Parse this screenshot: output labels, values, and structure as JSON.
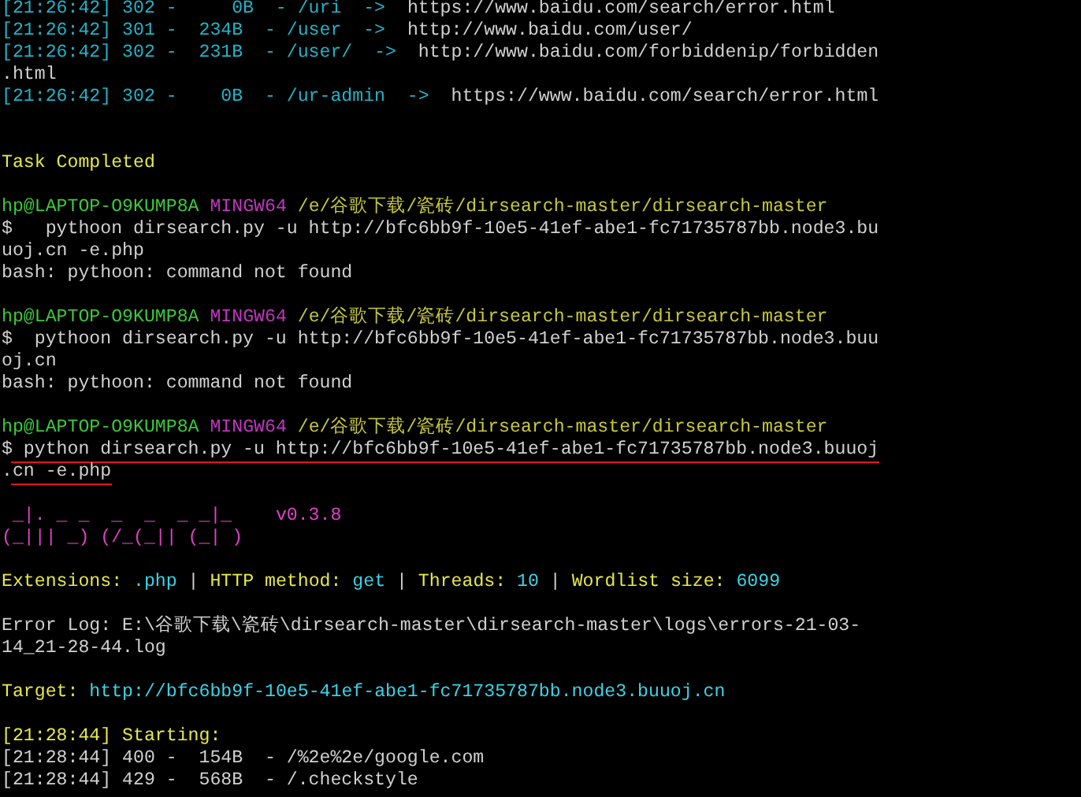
{
  "terminal": {
    "lines": [
      {
        "kind": "text",
        "segments": [
          {
            "text": "[21:26:42] 302 -     0B  - /uri  ->  ",
            "color": "#1fb4c8"
          },
          {
            "text": "https://www.baidu.com/search/error.html",
            "color": "#d0d0d0"
          }
        ]
      },
      {
        "kind": "text",
        "segments": [
          {
            "text": "[21:26:42] 301 -  234B  - /user  ->  ",
            "color": "#1fb4c8"
          },
          {
            "text": "http://www.baidu.com/user/",
            "color": "#d0d0d0"
          }
        ]
      },
      {
        "kind": "text",
        "segments": [
          {
            "text": "[21:26:42] 302 -  231B  - /user/  ->  ",
            "color": "#1fb4c8"
          },
          {
            "text": "http://www.baidu.com/forbiddenip/forbidden",
            "color": "#d0d0d0"
          }
        ]
      },
      {
        "kind": "text",
        "segments": [
          {
            "text": ".html",
            "color": "#d0d0d0"
          }
        ]
      },
      {
        "kind": "text",
        "segments": [
          {
            "text": "[21:26:42] 302 -    0B  - /ur-admin  ->  ",
            "color": "#1fb4c8"
          },
          {
            "text": "https://www.baidu.com/search/error.html",
            "color": "#d0d0d0"
          }
        ]
      },
      {
        "kind": "blank"
      },
      {
        "kind": "blank"
      },
      {
        "kind": "text",
        "segments": [
          {
            "text": "Task Completed",
            "color": "#e6e64c"
          }
        ]
      },
      {
        "kind": "blank"
      },
      {
        "kind": "text",
        "segments": [
          {
            "text": "hp@LAPTOP-O9KUMP8A ",
            "color": "#3cc83c"
          },
          {
            "text": "MINGW64 ",
            "color": "#c036c0"
          },
          {
            "text": "/e/谷歌下载/瓷砖/dirsearch-master/dirsearch-master",
            "color": "#c8c83a"
          }
        ]
      },
      {
        "kind": "text",
        "segments": [
          {
            "text": "$   pythoon dirsearch.py -u http://bfc6bb9f-10e5-41ef-abe1-fc71735787bb.node3.bu",
            "color": "#d0d0d0"
          }
        ]
      },
      {
        "kind": "text",
        "segments": [
          {
            "text": "uoj.cn -e.php",
            "color": "#d0d0d0"
          }
        ]
      },
      {
        "kind": "text",
        "segments": [
          {
            "text": "bash: pythoon: command not found",
            "color": "#d0d0d0"
          }
        ]
      },
      {
        "kind": "blank"
      },
      {
        "kind": "text",
        "segments": [
          {
            "text": "hp@LAPTOP-O9KUMP8A ",
            "color": "#3cc83c"
          },
          {
            "text": "MINGW64 ",
            "color": "#c036c0"
          },
          {
            "text": "/e/谷歌下载/瓷砖/dirsearch-master/dirsearch-master",
            "color": "#c8c83a"
          }
        ]
      },
      {
        "kind": "text",
        "segments": [
          {
            "text": "$  pythoon dirsearch.py -u http://bfc6bb9f-10e5-41ef-abe1-fc71735787bb.node3.buu",
            "color": "#d0d0d0"
          }
        ]
      },
      {
        "kind": "text",
        "segments": [
          {
            "text": "oj.cn",
            "color": "#d0d0d0"
          }
        ]
      },
      {
        "kind": "text",
        "segments": [
          {
            "text": "bash: pythoon: command not found",
            "color": "#d0d0d0"
          }
        ]
      },
      {
        "kind": "blank"
      },
      {
        "kind": "text",
        "segments": [
          {
            "text": "hp@LAPTOP-O9KUMP8A ",
            "color": "#3cc83c"
          },
          {
            "text": "MINGW64 ",
            "color": "#c036c0"
          },
          {
            "text": "/e/谷歌下载/瓷砖/dirsearch-master/dirsearch-master",
            "color": "#c8c83a"
          }
        ]
      },
      {
        "kind": "text",
        "underlined": true,
        "segments": [
          {
            "text": "$ python dirsearch.py -u http://bfc6bb9f-10e5-41ef-abe1-fc71735787bb.node3.buuoj",
            "color": "#d0d0d0"
          }
        ]
      },
      {
        "kind": "text",
        "underlined": true,
        "segments": [
          {
            "text": ".cn -e.php",
            "color": "#d0d0d0"
          }
        ]
      },
      {
        "kind": "blank"
      },
      {
        "kind": "text",
        "segments": [
          {
            "text": " _|. _ _  _  _  _ _|_    ",
            "color": "#e040c8"
          },
          {
            "text": "v0.3.8",
            "color": "#e040c8"
          }
        ]
      },
      {
        "kind": "text",
        "segments": [
          {
            "text": "(_||| _) (/_(_|| (_| )",
            "color": "#e040c8"
          }
        ]
      },
      {
        "kind": "blank"
      },
      {
        "kind": "text",
        "segments": [
          {
            "text": "Extensions: ",
            "color": "#e6e64c"
          },
          {
            "text": ".php",
            "color": "#3ad4e8"
          },
          {
            "text": " | ",
            "color": "#d0d0d0"
          },
          {
            "text": "HTTP method: ",
            "color": "#e6e64c"
          },
          {
            "text": "get",
            "color": "#3ad4e8"
          },
          {
            "text": " | ",
            "color": "#d0d0d0"
          },
          {
            "text": "Threads: ",
            "color": "#e6e64c"
          },
          {
            "text": "10",
            "color": "#3ad4e8"
          },
          {
            "text": " | ",
            "color": "#d0d0d0"
          },
          {
            "text": "Wordlist size: ",
            "color": "#e6e64c"
          },
          {
            "text": "6099",
            "color": "#3ad4e8"
          }
        ]
      },
      {
        "kind": "blank"
      },
      {
        "kind": "text",
        "segments": [
          {
            "text": "Error Log: E:\\谷歌下载\\瓷砖\\dirsearch-master\\dirsearch-master\\logs\\errors-21-03-",
            "color": "#d0d0d0"
          }
        ]
      },
      {
        "kind": "text",
        "segments": [
          {
            "text": "14_21-28-44.log",
            "color": "#d0d0d0"
          }
        ]
      },
      {
        "kind": "blank"
      },
      {
        "kind": "text",
        "segments": [
          {
            "text": "Target: ",
            "color": "#e6e64c"
          },
          {
            "text": "http://bfc6bb9f-10e5-41ef-abe1-fc71735787bb.node3.buuoj.cn",
            "color": "#3ad4e8"
          }
        ]
      },
      {
        "kind": "blank"
      },
      {
        "kind": "text",
        "segments": [
          {
            "text": "[21:28:44] Starting:",
            "color": "#e6e64c"
          }
        ]
      },
      {
        "kind": "text",
        "segments": [
          {
            "text": "[21:28:44] 400 -  154B  - /%2e%2e/google.com",
            "color": "#d0d0d0"
          }
        ]
      },
      {
        "kind": "text",
        "segments": [
          {
            "text": "[21:28:44] 429 -  568B  - /.checkstyle",
            "color": "#d0d0d0"
          }
        ]
      }
    ]
  }
}
